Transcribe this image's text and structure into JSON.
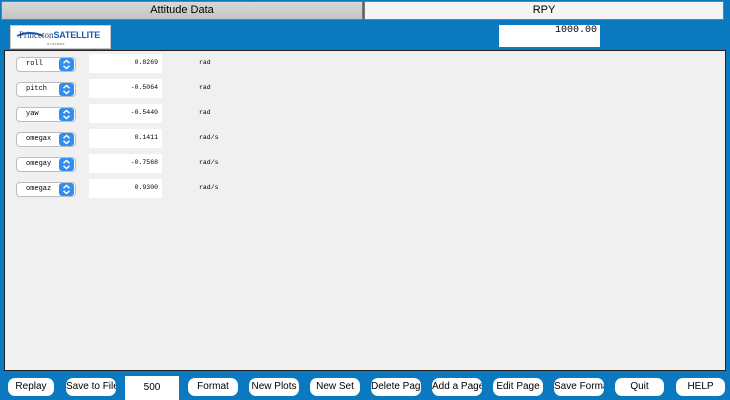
{
  "tabs": [
    {
      "label": "Attitude Data",
      "selected": false
    },
    {
      "label": "RPY",
      "selected": true
    }
  ],
  "logo": {
    "text": "Princeton",
    "brand": "SATELLITE",
    "subtext": "SYSTEMS"
  },
  "time_field": {
    "value": "1000.00"
  },
  "rows": [
    {
      "variable": "roll",
      "value": "0.8269",
      "unit": "rad"
    },
    {
      "variable": "pitch",
      "value": "-0.5064",
      "unit": "rad"
    },
    {
      "variable": "yaw",
      "value": "-0.5440",
      "unit": "rad"
    },
    {
      "variable": "omegax",
      "value": "0.1411",
      "unit": "rad/s"
    },
    {
      "variable": "omegay",
      "value": "-0.7568",
      "unit": "rad/s"
    },
    {
      "variable": "omegaz",
      "value": "0.9300",
      "unit": "rad/s"
    }
  ],
  "bottom": {
    "replay": "Replay",
    "save_to_file": "Save to File",
    "points": "500",
    "format": "Format",
    "new_plots": "New Plots",
    "new_set": "New Set",
    "delete_page": "Delete Page",
    "add_page": "Add a Page",
    "edit_page": "Edit Page",
    "save_format": "Save Format",
    "quit": "Quit",
    "help": "HELP"
  },
  "colors": {
    "background": "#0a79c0",
    "panel": "#f0f0f0",
    "select_button": "#2f8ef0"
  },
  "icons": {
    "select_arrow": "chevron-up-down-icon"
  }
}
